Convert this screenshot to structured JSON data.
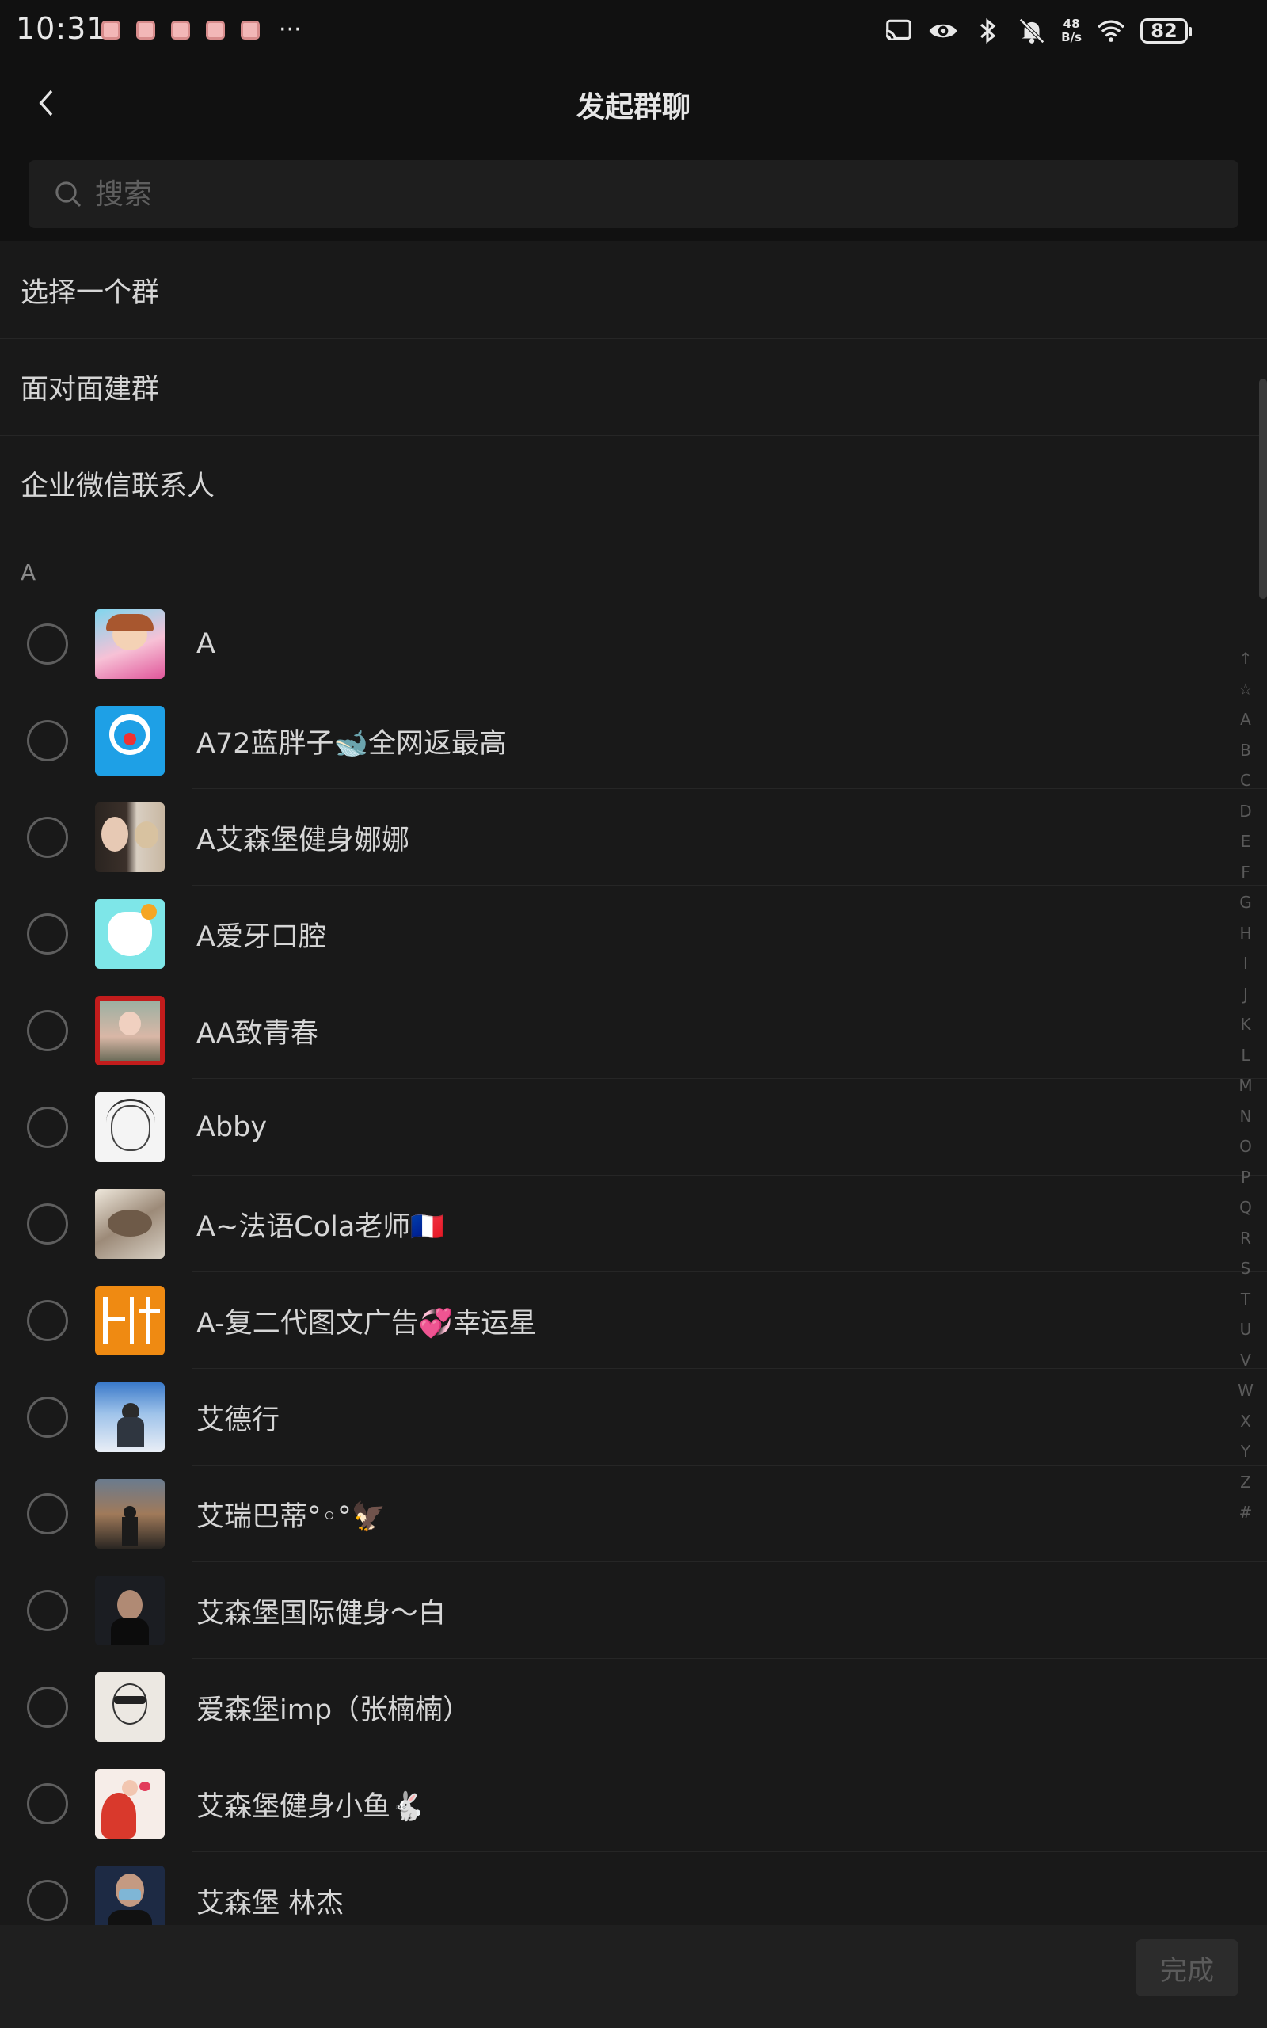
{
  "status_bar": {
    "time": "10:31",
    "more": "···",
    "net_speed_value": "48",
    "net_speed_unit": "B/s",
    "battery": "82"
  },
  "header": {
    "title": "发起群聊"
  },
  "search": {
    "placeholder": "搜索"
  },
  "options": [
    {
      "label": "选择一个群"
    },
    {
      "label": "面对面建群"
    },
    {
      "label": "企业微信联系人"
    }
  ],
  "section": {
    "letter": "A"
  },
  "contacts": [
    {
      "name": "A"
    },
    {
      "name": "A72蓝胖子🐋全网返最高"
    },
    {
      "name": "A艾森堡健身娜娜"
    },
    {
      "name": "A爱牙口腔"
    },
    {
      "name": "AA致青春"
    },
    {
      "name": "Abby"
    },
    {
      "name": "A~法语Cola老师🇫🇷"
    },
    {
      "name": "A-复二代图文广告💞幸运星"
    },
    {
      "name": "艾德行"
    },
    {
      "name": "艾瑞巴蒂°◦°🦅"
    },
    {
      "name": "艾森堡国际健身～白"
    },
    {
      "name": "爱森堡imp（张楠楠）"
    },
    {
      "name": "艾森堡健身小鱼🐇"
    },
    {
      "name": "艾森堡 林杰"
    }
  ],
  "index_letters": [
    "↑",
    "☆",
    "A",
    "B",
    "C",
    "D",
    "E",
    "F",
    "G",
    "H",
    "I",
    "J",
    "K",
    "L",
    "M",
    "N",
    "O",
    "P",
    "Q",
    "R",
    "S",
    "T",
    "U",
    "V",
    "W",
    "X",
    "Y",
    "Z",
    "#"
  ],
  "footer": {
    "done_label": "完成"
  },
  "colors": {
    "background": "#191919",
    "bar": "#111111",
    "text": "#d6d6d6",
    "muted": "#5a5a5a"
  }
}
